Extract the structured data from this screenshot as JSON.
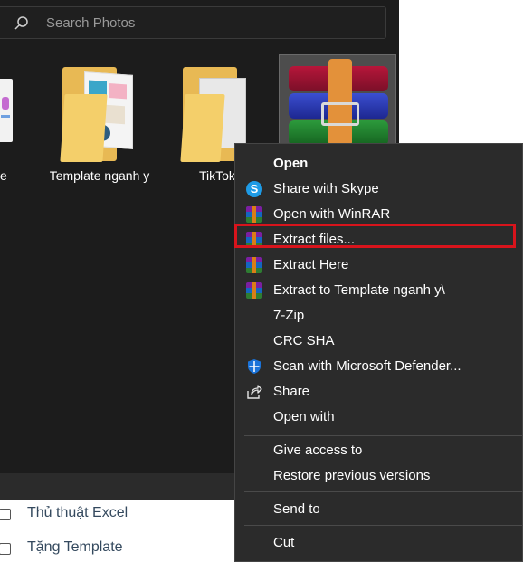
{
  "explorer": {
    "search": {
      "placeholder": "Search Photos"
    },
    "files": [
      {
        "label": "e"
      },
      {
        "label": "Template nganh y"
      },
      {
        "label": "TikTok"
      },
      {
        "label": ""
      }
    ]
  },
  "context_menu": {
    "items": [
      {
        "label": "Open",
        "icon": "none"
      },
      {
        "label": "Share with Skype",
        "icon": "skype-icon"
      },
      {
        "label": "Open with WinRAR",
        "icon": "winrar-icon"
      },
      {
        "label": "Extract files...",
        "icon": "winrar-icon"
      },
      {
        "label": "Extract Here",
        "icon": "winrar-icon"
      },
      {
        "label": "Extract to Template nganh y\\",
        "icon": "winrar-icon"
      },
      {
        "label": "7-Zip",
        "icon": "none"
      },
      {
        "label": "CRC SHA",
        "icon": "none"
      },
      {
        "label": "Scan with Microsoft Defender...",
        "icon": "defender-shield-icon"
      },
      {
        "label": "Share",
        "icon": "share-icon"
      },
      {
        "label": "Open with",
        "icon": "none"
      },
      {
        "label": "Give access to",
        "icon": "none"
      },
      {
        "label": "Restore previous versions",
        "icon": "none"
      },
      {
        "label": "Send to",
        "icon": "none"
      },
      {
        "label": "Cut",
        "icon": "none"
      }
    ],
    "highlighted_item": "Extract files...",
    "highlight_color": "#d8141c"
  },
  "background_page": {
    "items": [
      {
        "label": "Thủ thuật Excel"
      },
      {
        "label": "Tặng Template"
      }
    ]
  }
}
